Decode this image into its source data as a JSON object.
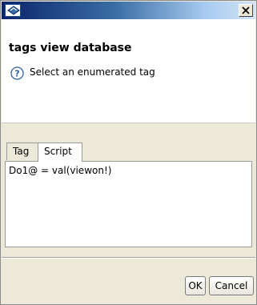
{
  "window": {
    "title_icon": "dialog-app-icon",
    "close_icon": "close-icon"
  },
  "header": {
    "title": "tags view database",
    "message": "Select an enumerated tag",
    "message_icon": "help-icon"
  },
  "tabs": [
    {
      "label": "Tag",
      "selected": false
    },
    {
      "label": "Script",
      "selected": true
    }
  ],
  "script": {
    "value": "Do1@ = val(viewon!)"
  },
  "buttons": {
    "ok_label": "OK",
    "cancel_label": "Cancel"
  }
}
